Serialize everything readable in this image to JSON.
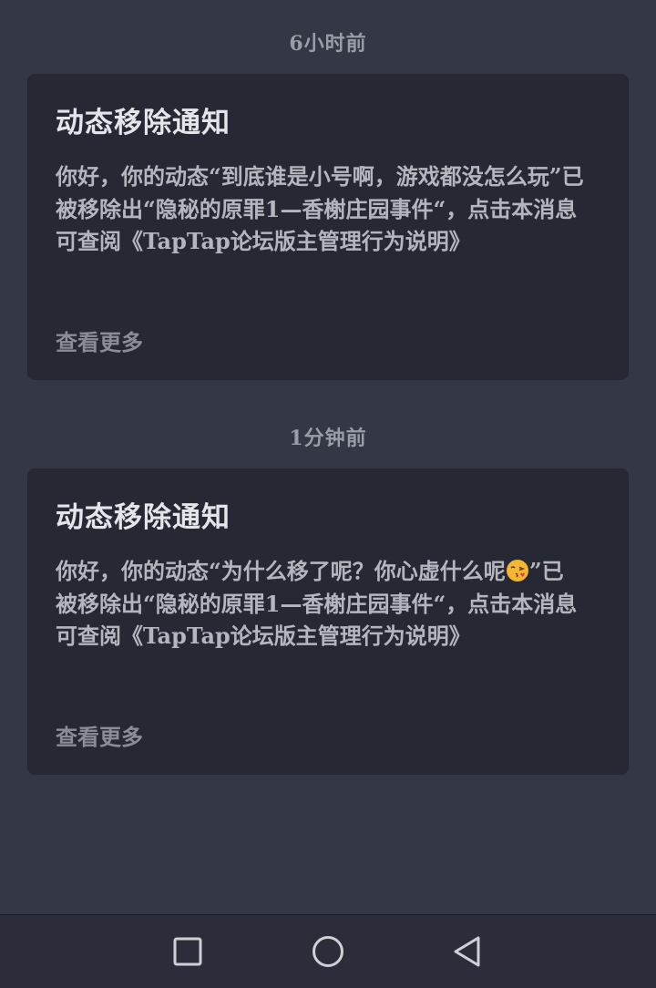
{
  "notifications": [
    {
      "time": "6小时前",
      "title": "动态移除通知",
      "body_before": "你好，你的动态“到底谁是小号啊，游戏都没怎么玩”已被移除出“隐秘的原罪1—香榭庄园事件“，点击本消息可查阅《TapTap论坛版主管理行为说明》",
      "more": "查看更多"
    },
    {
      "time": "1分钟前",
      "title": "动态移除通知",
      "body_before": "你好，你的动态“为什么移了呢？你心虚什么呢",
      "emoji": "kissing-face-with-heart-emoji",
      "body_after": "”已被移除出“隐秘的原罪1—香榭庄园事件“，点击本消息可查阅《TapTap论坛版主管理行为说明》",
      "more": "查看更多"
    }
  ],
  "nav": {
    "recent": "square-icon",
    "home": "circle-icon",
    "back": "triangle-back-icon"
  }
}
